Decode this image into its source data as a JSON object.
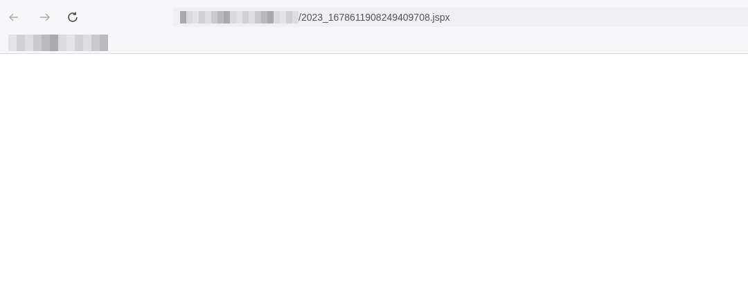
{
  "address_bar": {
    "url": "/2023_1678611908249409708.jspx"
  }
}
